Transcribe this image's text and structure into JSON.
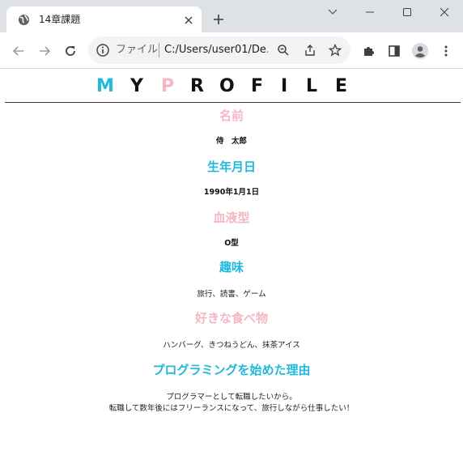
{
  "browser": {
    "tab_title": "14章課題",
    "address_label": "ファイル",
    "address_url": "C:/Users/user01/De..."
  },
  "logo": {
    "letters": [
      "M",
      "Y",
      "P",
      "R",
      "O",
      "F",
      "I",
      "L",
      "E"
    ],
    "colors": {
      "cyan": "#1fb9dc",
      "pink": "#f4b6c2",
      "black": "#111111"
    }
  },
  "profile": {
    "name_heading": "名前",
    "name_value": "侍　太郎",
    "birthday_heading": "生年月日",
    "birthday_value": "1990年1月1日",
    "blood_heading": "血液型",
    "blood_value": "O型",
    "hobby_heading": "趣味",
    "hobby_value": "旅行、読書、ゲーム",
    "food_heading": "好きな食べ物",
    "food_value": "ハンバーグ、きつねうどん、抹茶アイス",
    "reason_heading": "プログラミングを始めた理由",
    "reason_line1": "プログラマーとして転職したいから。",
    "reason_line2": "転職して数年後にはフリーランスになって、旅行しながら仕事したい！"
  }
}
